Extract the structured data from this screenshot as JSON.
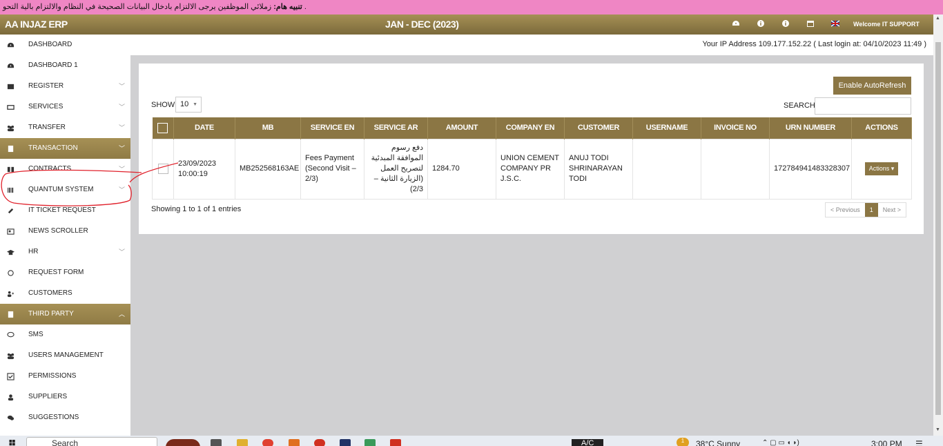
{
  "ticker": {
    "prefix": ".",
    "bold": "تنبيه هام:",
    "text": "زملائي الموظفين يرجى الالتزام بادخال البيانات الصحيحة في النظام والالتزام بالية التحو"
  },
  "header": {
    "brand": "AA INJAZ ERP",
    "period": "JAN - DEC (2023)",
    "welcome": "Welcome IT SUPPORT",
    "badges": [
      "",
      ""
    ]
  },
  "ip_info": "Your IP Address 109.177.152.22 ( Last login at: 04/10/2023 11:49 )",
  "sidebar": {
    "items": [
      {
        "label": "DASHBOARD",
        "icon": "dashboard-icon",
        "chev": false,
        "active": false
      },
      {
        "label": "DASHBOARD 1",
        "icon": "dashboard-icon",
        "chev": false,
        "active": false
      },
      {
        "label": "REGISTER",
        "icon": "register-icon",
        "chev": true,
        "active": false
      },
      {
        "label": "SERVICES",
        "icon": "services-icon",
        "chev": true,
        "active": false
      },
      {
        "label": "TRANSFER",
        "icon": "users-icon",
        "chev": true,
        "active": false
      },
      {
        "label": "TRANSACTION",
        "icon": "document-icon",
        "chev": true,
        "active": true
      },
      {
        "label": "CONTRACTS",
        "icon": "contract-icon",
        "chev": true,
        "active": false
      },
      {
        "label": "QUANTUM SYSTEM",
        "icon": "barcode-icon",
        "chev": true,
        "active": false
      },
      {
        "label": "IT TICKET REQUEST",
        "icon": "ticket-icon",
        "chev": false,
        "active": false
      },
      {
        "label": "NEWS SCROLLER",
        "icon": "news-icon",
        "chev": false,
        "active": false
      },
      {
        "label": "HR",
        "icon": "graduation-icon",
        "chev": true,
        "active": false
      },
      {
        "label": "REQUEST FORM",
        "icon": "hand-icon",
        "chev": false,
        "active": false
      },
      {
        "label": "CUSTOMERS",
        "icon": "add-user-icon",
        "chev": false,
        "active": false
      },
      {
        "label": "THIRD PARTY",
        "icon": "document-icon",
        "chev": true,
        "active": true
      },
      {
        "label": "SMS",
        "icon": "chat-icon",
        "chev": false,
        "active": false
      },
      {
        "label": "USERS MANAGEMENT",
        "icon": "users-icon",
        "chev": false,
        "active": false
      },
      {
        "label": "PERMISSIONS",
        "icon": "check-icon",
        "chev": false,
        "active": false
      },
      {
        "label": "SUPPLIERS",
        "icon": "user-icon",
        "chev": false,
        "active": false
      },
      {
        "label": "SUGGESTIONS",
        "icon": "comments-icon",
        "chev": false,
        "active": false
      }
    ]
  },
  "panel": {
    "autorefresh_label": "Enable AutoRefresh",
    "show_label": "SHOW",
    "show_value": "10",
    "search_label": "SEARCH",
    "search_value": "",
    "columns": [
      "DATE",
      "MB",
      "SERVICE EN",
      "SERVICE AR",
      "AMOUNT",
      "COMPANY EN",
      "CUSTOMER",
      "USERNAME",
      "INVOICE NO",
      "URN NUMBER",
      "ACTIONS"
    ],
    "rows": [
      {
        "date": "23/09/2023 10:00:19",
        "mb": "MB252568163AE",
        "service_en": "Fees Payment (Second Visit – 2/3)",
        "service_ar": "دفع رسوم الموافقة المبدئية لتصريح العمل (الزيارة الثانية – 2/3)",
        "amount": "1284.70",
        "company_en": "UNION CEMENT COMPANY PR J.S.C.",
        "customer": "ANUJ TODI SHRINARAYAN TODI",
        "username": "",
        "invoice_no": "",
        "urn": "172784941483328307",
        "action_label": "Actions"
      }
    ],
    "info": "Showing 1 to 1 of 1 entries",
    "pager": {
      "prev": "< Previous",
      "current": "1",
      "next": "Next >"
    }
  },
  "taskbar": {
    "search": "Search",
    "keyboard": "A/C",
    "weather": "38°C  Sunny",
    "time": "3:00 PM",
    "notif": "1"
  },
  "colors": {
    "accent": "#8b7644",
    "ticker": "#ef86c4",
    "annotation": "#e0202a"
  }
}
